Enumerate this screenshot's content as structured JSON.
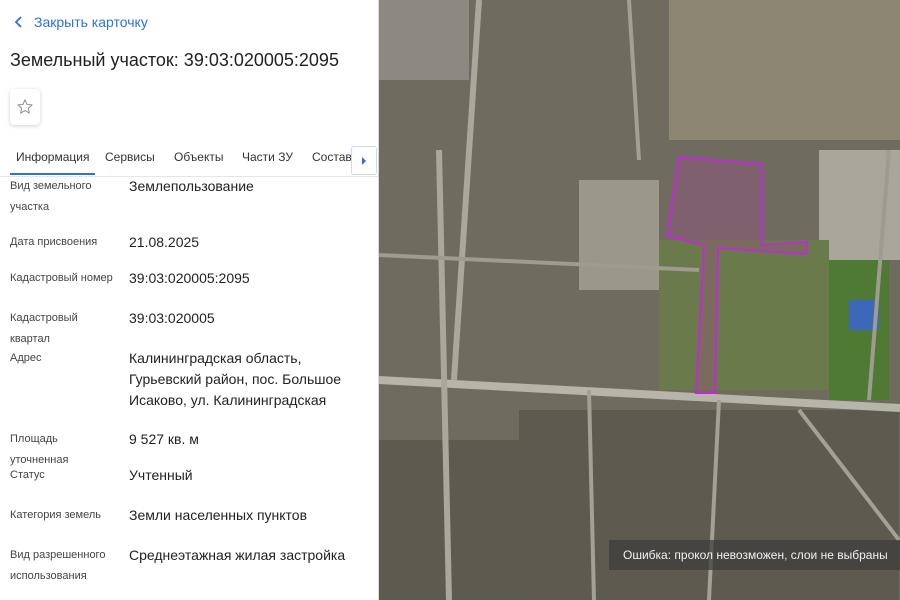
{
  "card": {
    "close_label": "Закрыть карточку",
    "title": "Земельный участок: 39:03:020005:2095"
  },
  "tabs": [
    "Информация",
    "Сервисы",
    "Объекты",
    "Части ЗУ",
    "Состав"
  ],
  "fields": [
    {
      "label": "Вид земельного участка",
      "value": "Землепользование"
    },
    {
      "label": "Дата присвоения",
      "value": "21.08.2025"
    },
    {
      "label": "Кадастровый номер",
      "value": "39:03:020005:2095"
    },
    {
      "label": "Кадастровый квартал",
      "value": "39:03:020005"
    },
    {
      "label": "Адрес",
      "value": "Калининградская область, Гурьевский район, пос. Большое Исаково, ул. Калининградская"
    },
    {
      "label": "Площадь уточненная",
      "value": "9 527 кв. м"
    },
    {
      "label": "Статус",
      "value": "Учтенный"
    },
    {
      "label": "Категория земель",
      "value": "Земли населенных пунктов"
    },
    {
      "label": "Вид разрешенного использования",
      "value": "Среднеэтажная жилая застройка"
    }
  ],
  "map": {
    "error_message": "Ошибка: прокол невозможен, слои не выбраны"
  },
  "colors": {
    "accent": "#2f6fe0",
    "parcel_outline": "#c02bd6"
  },
  "icons": [
    "chevron-left-icon",
    "star-icon",
    "chevron-right-icon"
  ]
}
